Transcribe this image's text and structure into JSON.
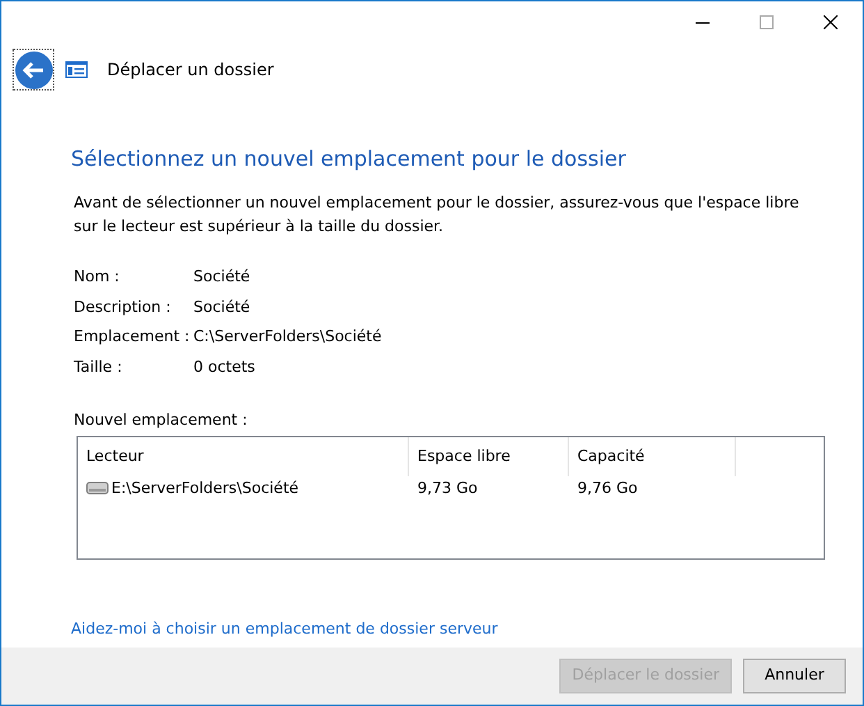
{
  "window": {
    "title": "Déplacer un dossier"
  },
  "heading": "Sélectionnez un nouvel emplacement pour le dossier",
  "intro": "Avant de sélectionner un nouvel emplacement pour le dossier, assurez-vous que l'espace libre sur le lecteur est supérieur à la taille du dossier.",
  "details": [
    {
      "label": "Nom :",
      "value": "Société"
    },
    {
      "label": "Description :",
      "value": "Société"
    },
    {
      "label": "Emplacement :",
      "value": "C:\\ServerFolders\\Société"
    },
    {
      "label": "Taille :",
      "value": "0 octets"
    }
  ],
  "new_location": {
    "label": "Nouvel emplacement :",
    "columns": [
      "Lecteur",
      "Espace libre",
      "Capacité"
    ],
    "rows": [
      {
        "cells": [
          "E:\\ServerFolders\\Société",
          "9,73 Go",
          "9,76 Go"
        ],
        "selected": false
      }
    ]
  },
  "help_link": "Aidez-moi à choisir un emplacement de dossier serveur",
  "buttons": [
    {
      "label": "Déplacer le dossier",
      "disabled": true
    },
    {
      "label": "Annuler",
      "disabled": false
    }
  ]
}
